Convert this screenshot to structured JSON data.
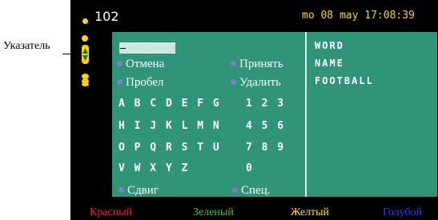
{
  "callout": {
    "label": "Указатель"
  },
  "topbar": {
    "channel": "102",
    "datetime": "mo 08 may 17:08:39"
  },
  "sidebar": {
    "icons": [
      "dot-icon",
      "scroll-arrows-icon",
      "stack-icon"
    ]
  },
  "editor": {
    "cursor": "_"
  },
  "options": {
    "cancel": "Отмена",
    "accept": "Принять",
    "space": "Пробел",
    "delete": "Удалить",
    "shift": "Сдвиг",
    "special": "Спец."
  },
  "keyboard": {
    "rows": [
      {
        "letters": "A B C D E F G",
        "digits": "1 2 3"
      },
      {
        "letters": "H I J K L M N",
        "digits": "4 5 6"
      },
      {
        "letters": "O P Q R S T U",
        "digits": "7 8 9"
      },
      {
        "letters": "V W X Y Z",
        "digits": "0"
      }
    ]
  },
  "history": [
    "WORD",
    "NAME",
    "FOOTBALL"
  ],
  "color_keys": [
    {
      "label": "Красный",
      "color": "#ff2020"
    },
    {
      "label": "Зеленый",
      "color": "#39c43f"
    },
    {
      "label": "Желтый",
      "color": "#ffe020"
    },
    {
      "label": "Голубой",
      "color": "#2040ff"
    }
  ]
}
